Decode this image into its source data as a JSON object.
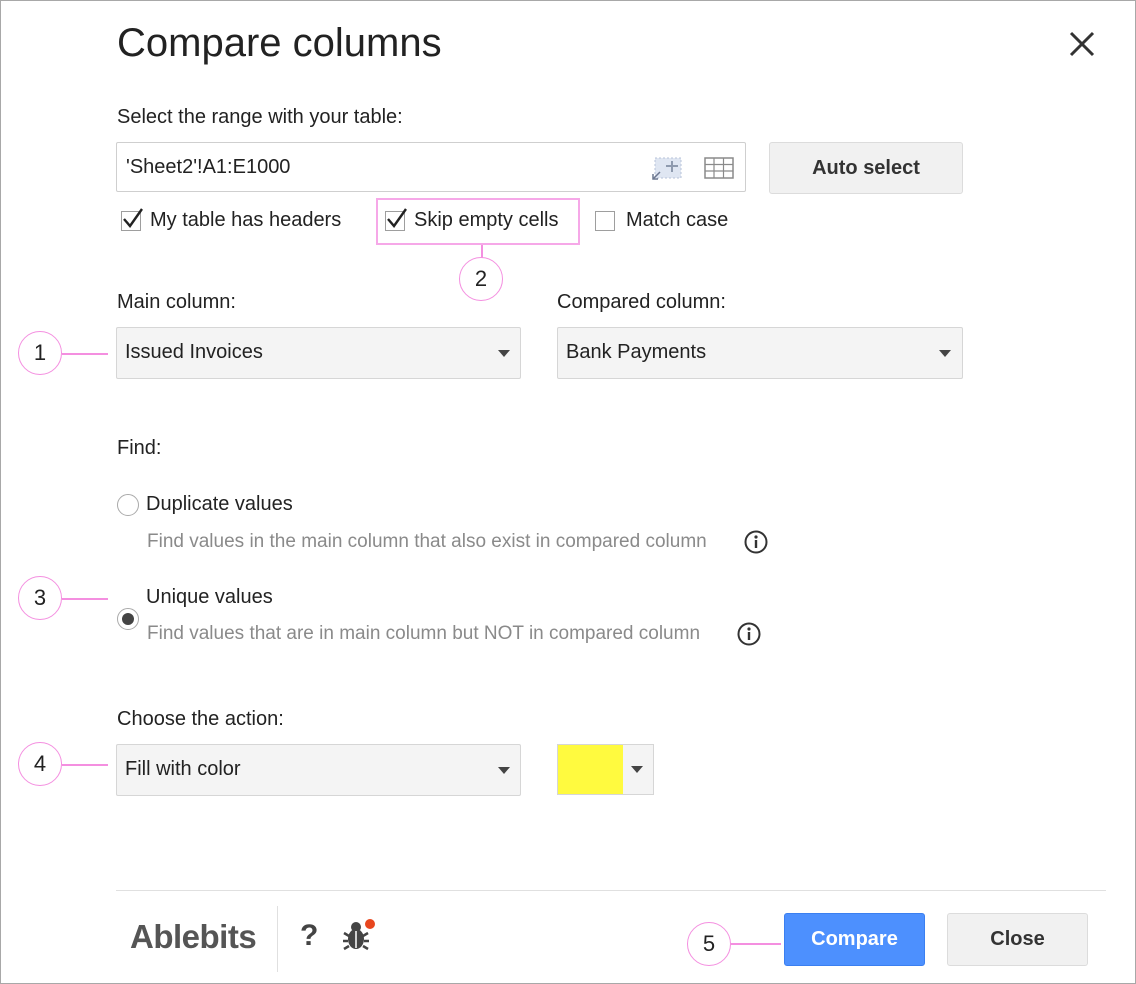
{
  "dialog": {
    "title": "Compare columns"
  },
  "range": {
    "label": "Select the range with your table:",
    "value": "'Sheet2'!A1:E1000",
    "auto_select_label": "Auto select"
  },
  "options": {
    "headers_label": "My table has headers",
    "headers_checked": true,
    "skip_empty_label": "Skip empty cells",
    "skip_empty_checked": true,
    "match_case_label": "Match case",
    "match_case_checked": false
  },
  "columns": {
    "main_label": "Main column:",
    "main_value": "Issued Invoices",
    "compared_label": "Compared column:",
    "compared_value": "Bank Payments"
  },
  "find": {
    "label": "Find:",
    "duplicate_label": "Duplicate values",
    "duplicate_desc": "Find values in the main column that also exist in compared column",
    "unique_label": "Unique values",
    "unique_desc": "Find values that are in main column but NOT in compared column",
    "selected": "unique"
  },
  "action": {
    "label": "Choose the action:",
    "value": "Fill with color",
    "color": "#fffa3f"
  },
  "footer": {
    "logo_text": "Ablebits",
    "help_label": "?",
    "compare_label": "Compare",
    "close_label": "Close"
  },
  "callouts": [
    "1",
    "2",
    "3",
    "4",
    "5"
  ],
  "colors": {
    "accent_blue": "#4d90fe",
    "callout_pink": "#f48fe0",
    "notification_dot": "#e8461e"
  }
}
